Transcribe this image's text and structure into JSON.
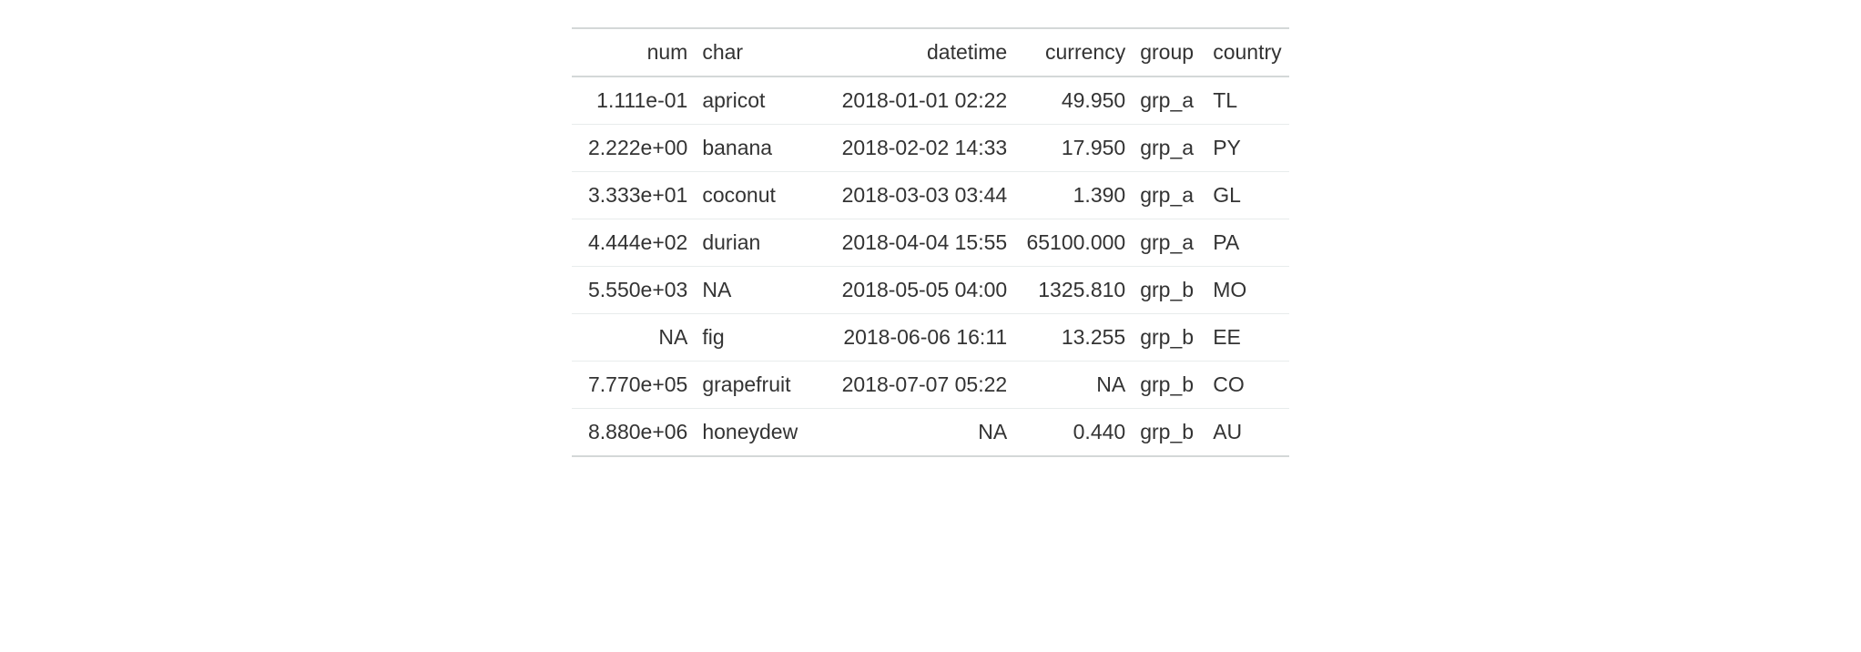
{
  "table": {
    "headers": {
      "num": "num",
      "char": "char",
      "datetime": "datetime",
      "currency": "currency",
      "group": "group",
      "country": "country"
    },
    "rows": [
      {
        "num": "1.111e-01",
        "char": "apricot",
        "datetime": "2018-01-01 02:22",
        "currency": "49.950",
        "group": "grp_a",
        "country": "TL"
      },
      {
        "num": "2.222e+00",
        "char": "banana",
        "datetime": "2018-02-02 14:33",
        "currency": "17.950",
        "group": "grp_a",
        "country": "PY"
      },
      {
        "num": "3.333e+01",
        "char": "coconut",
        "datetime": "2018-03-03 03:44",
        "currency": "1.390",
        "group": "grp_a",
        "country": "GL"
      },
      {
        "num": "4.444e+02",
        "char": "durian",
        "datetime": "2018-04-04 15:55",
        "currency": "65100.000",
        "group": "grp_a",
        "country": "PA"
      },
      {
        "num": "5.550e+03",
        "char": "NA",
        "datetime": "2018-05-05 04:00",
        "currency": "1325.810",
        "group": "grp_b",
        "country": "MO"
      },
      {
        "num": "NA",
        "char": "fig",
        "datetime": "2018-06-06 16:11",
        "currency": "13.255",
        "group": "grp_b",
        "country": "EE"
      },
      {
        "num": "7.770e+05",
        "char": "grapefruit",
        "datetime": "2018-07-07 05:22",
        "currency": "NA",
        "group": "grp_b",
        "country": "CO"
      },
      {
        "num": "8.880e+06",
        "char": "honeydew",
        "datetime": "NA",
        "currency": "0.440",
        "group": "grp_b",
        "country": "AU"
      }
    ]
  }
}
